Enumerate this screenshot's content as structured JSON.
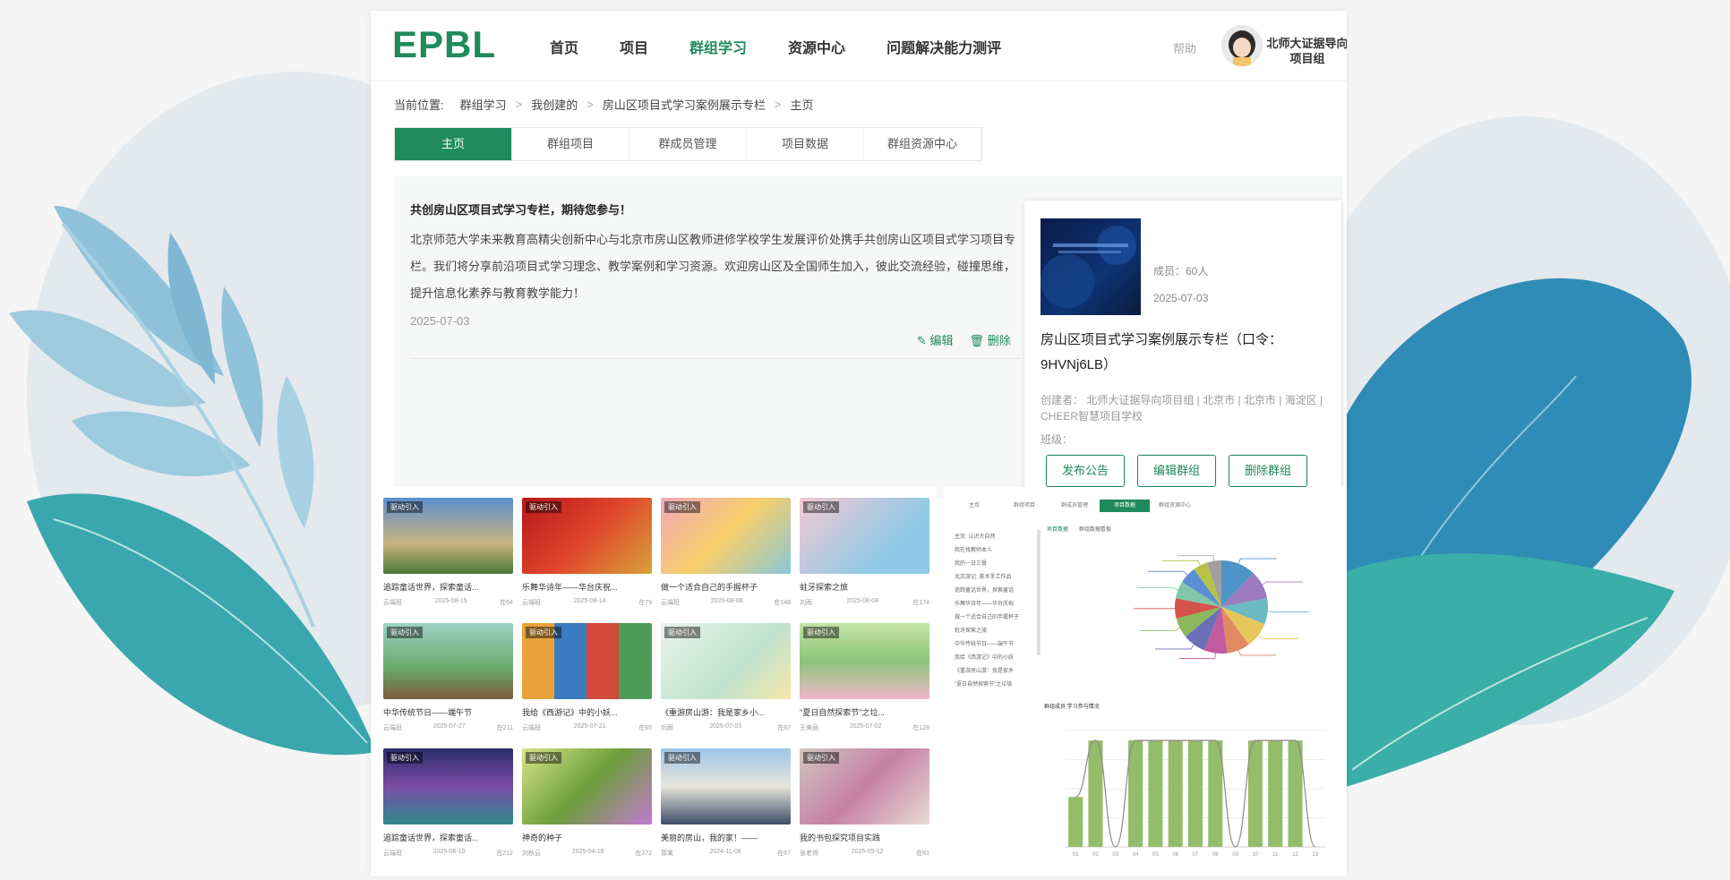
{
  "app": {
    "logo": "EPBL",
    "nav": [
      "首页",
      "项目",
      "群组学习",
      "资源中心",
      "问题解决能力测评"
    ],
    "nav_active": 2,
    "help": "帮助",
    "user_name_line1": "北师大证据导向",
    "user_name_line2": "项目组"
  },
  "breadcrumb": {
    "prefix": "当前位置:",
    "items": [
      "群组学习",
      "我创建的",
      "房山区项目式学习案例展示专栏",
      "主页"
    ],
    "sep": ">"
  },
  "tabs": [
    "主页",
    "群组项目",
    "群成员管理",
    "项目数据",
    "群组资源中心"
  ],
  "tab_active": 0,
  "notice": {
    "title": "共创房山区项目式学习专栏，期待您参与！",
    "body": "北京师范大学未来教育高精尖创新中心与北京市房山区教师进修学校学生发展评价处携手共创房山区项目式学习项目专栏。我们将分享前沿项目式学习理念、教学案例和学习资源。欢迎房山区及全国师生加入，彼此交流经验，碰撞思维，提升信息化素养与教育教学能力！",
    "date": "2025-07-03",
    "edit": "编辑",
    "delete": "删除"
  },
  "group_card": {
    "members": "成员：60人",
    "date": "2025-07-03",
    "title": "房山区项目式学习案例展示专栏（口令：9HVNj6LB）",
    "creator": "创建者：  北师大证据导向项目组 | 北京市 | 北京市 | 海淀区 | CHEER智慧项目学校",
    "class_label": "班级：",
    "btn_publish": "发布公告",
    "btn_edit": "编辑群组",
    "btn_delete": "删除群组"
  },
  "projects": [
    {
      "tag": "驱动引入",
      "title": "追踪童话世界，探索童话...",
      "meta_left": "云端班",
      "meta_mid": "2025-08-15",
      "meta_right": "在64"
    },
    {
      "tag": "驱动引入",
      "title": "乐舞华诗年——华台庆祝...",
      "meta_left": "云端班",
      "meta_mid": "2025-08-14",
      "meta_right": "在79"
    },
    {
      "tag": "驱动引入",
      "title": "做一个适合自己的手握杯子",
      "meta_left": "云端班",
      "meta_mid": "2025-08-08",
      "meta_right": "在148"
    },
    {
      "tag": "驱动引入",
      "title": "蛀牙探索之旅",
      "meta_left": "刘雨",
      "meta_mid": "2025-08-04",
      "meta_right": "在174"
    },
    {
      "tag": "驱动引入",
      "title": "中华传统节日——端午节",
      "meta_left": "云端班",
      "meta_mid": "2025-07-27",
      "meta_right": "在211"
    },
    {
      "tag": "驱动引入",
      "title": "我给《西游记》中的小妖...",
      "meta_left": "云端班",
      "meta_mid": "2025-07-21",
      "meta_right": "在65"
    },
    {
      "tag": "驱动引入",
      "title": "《重游房山游：我是家乡小...",
      "meta_left": "刘雨",
      "meta_mid": "2025-07-03",
      "meta_right": "在67"
    },
    {
      "tag": "驱动引入",
      "title": "\"夏日自然探索节\"之垃...",
      "meta_left": "王美丽",
      "meta_mid": "2025-07-02",
      "meta_right": "在128"
    },
    {
      "tag": "驱动引入",
      "title": "追踪童话世界，探索童话...",
      "meta_left": "云端班",
      "meta_mid": "2025-06-10",
      "meta_right": "在212"
    },
    {
      "tag": "驱动引入",
      "title": "神奇的种子",
      "meta_left": "刘秋云",
      "meta_mid": "2025-04-18",
      "meta_right": "在272"
    },
    {
      "tag": "驱动引入",
      "title": "美丽的房山，我的家！——",
      "meta_left": "郭某",
      "meta_mid": "2024-11-08",
      "meta_right": "在67"
    },
    {
      "tag": "驱动引入",
      "title": "我的书包探究项目实践",
      "meta_left": "张老师",
      "meta_mid": "2025-05-12",
      "meta_right": "在81"
    }
  ],
  "data_panel": {
    "tabs": [
      "主页",
      "群组项目",
      "群成员管理",
      "项目数据",
      "群组资源中心"
    ],
    "active_tab": 3,
    "sub_tabs": [
      "项目数据",
      "群组数据看板"
    ],
    "list": [
      "主页: 认识大自然",
      "我在找教师本人",
      "我的一日三餐",
      "北京游记: 美术手工作品",
      "追踪童话世界，探索童话",
      "乐舞华诗年——华台庆祝",
      "做一个适合自己的手握杯子",
      "蛀牙探索之旅",
      "中华传统节日——端午节",
      "我给《西游记》中的小妖",
      "《重游房山游：我是家乡",
      "\"夏日自然探索节\"之垃圾"
    ],
    "bar_chart_title": "群组成员 学习参与情况"
  },
  "chart_data": [
    {
      "type": "pie",
      "values": [
        12,
        10,
        9,
        9,
        8,
        8,
        8,
        7,
        7,
        6,
        6,
        5,
        5
      ],
      "colors": [
        "#4e94c9",
        "#9c7bc0",
        "#6bbac4",
        "#e6c65a",
        "#e08a64",
        "#c45aa0",
        "#6b6fb8",
        "#8bb85a",
        "#d4534a",
        "#7fc7a8",
        "#5a8fd4",
        "#b7c245",
        "#a0a0a0"
      ]
    },
    {
      "type": "bar",
      "categories": [
        "01",
        "02",
        "03",
        "04",
        "05",
        "06",
        "07",
        "08",
        "09",
        "10",
        "11",
        "12",
        "13"
      ],
      "values": [
        30,
        64,
        0,
        64,
        64,
        64,
        64,
        64,
        0,
        64,
        64,
        64,
        0
      ],
      "ylim": [
        0,
        70
      ],
      "color": "#93bd68"
    }
  ]
}
